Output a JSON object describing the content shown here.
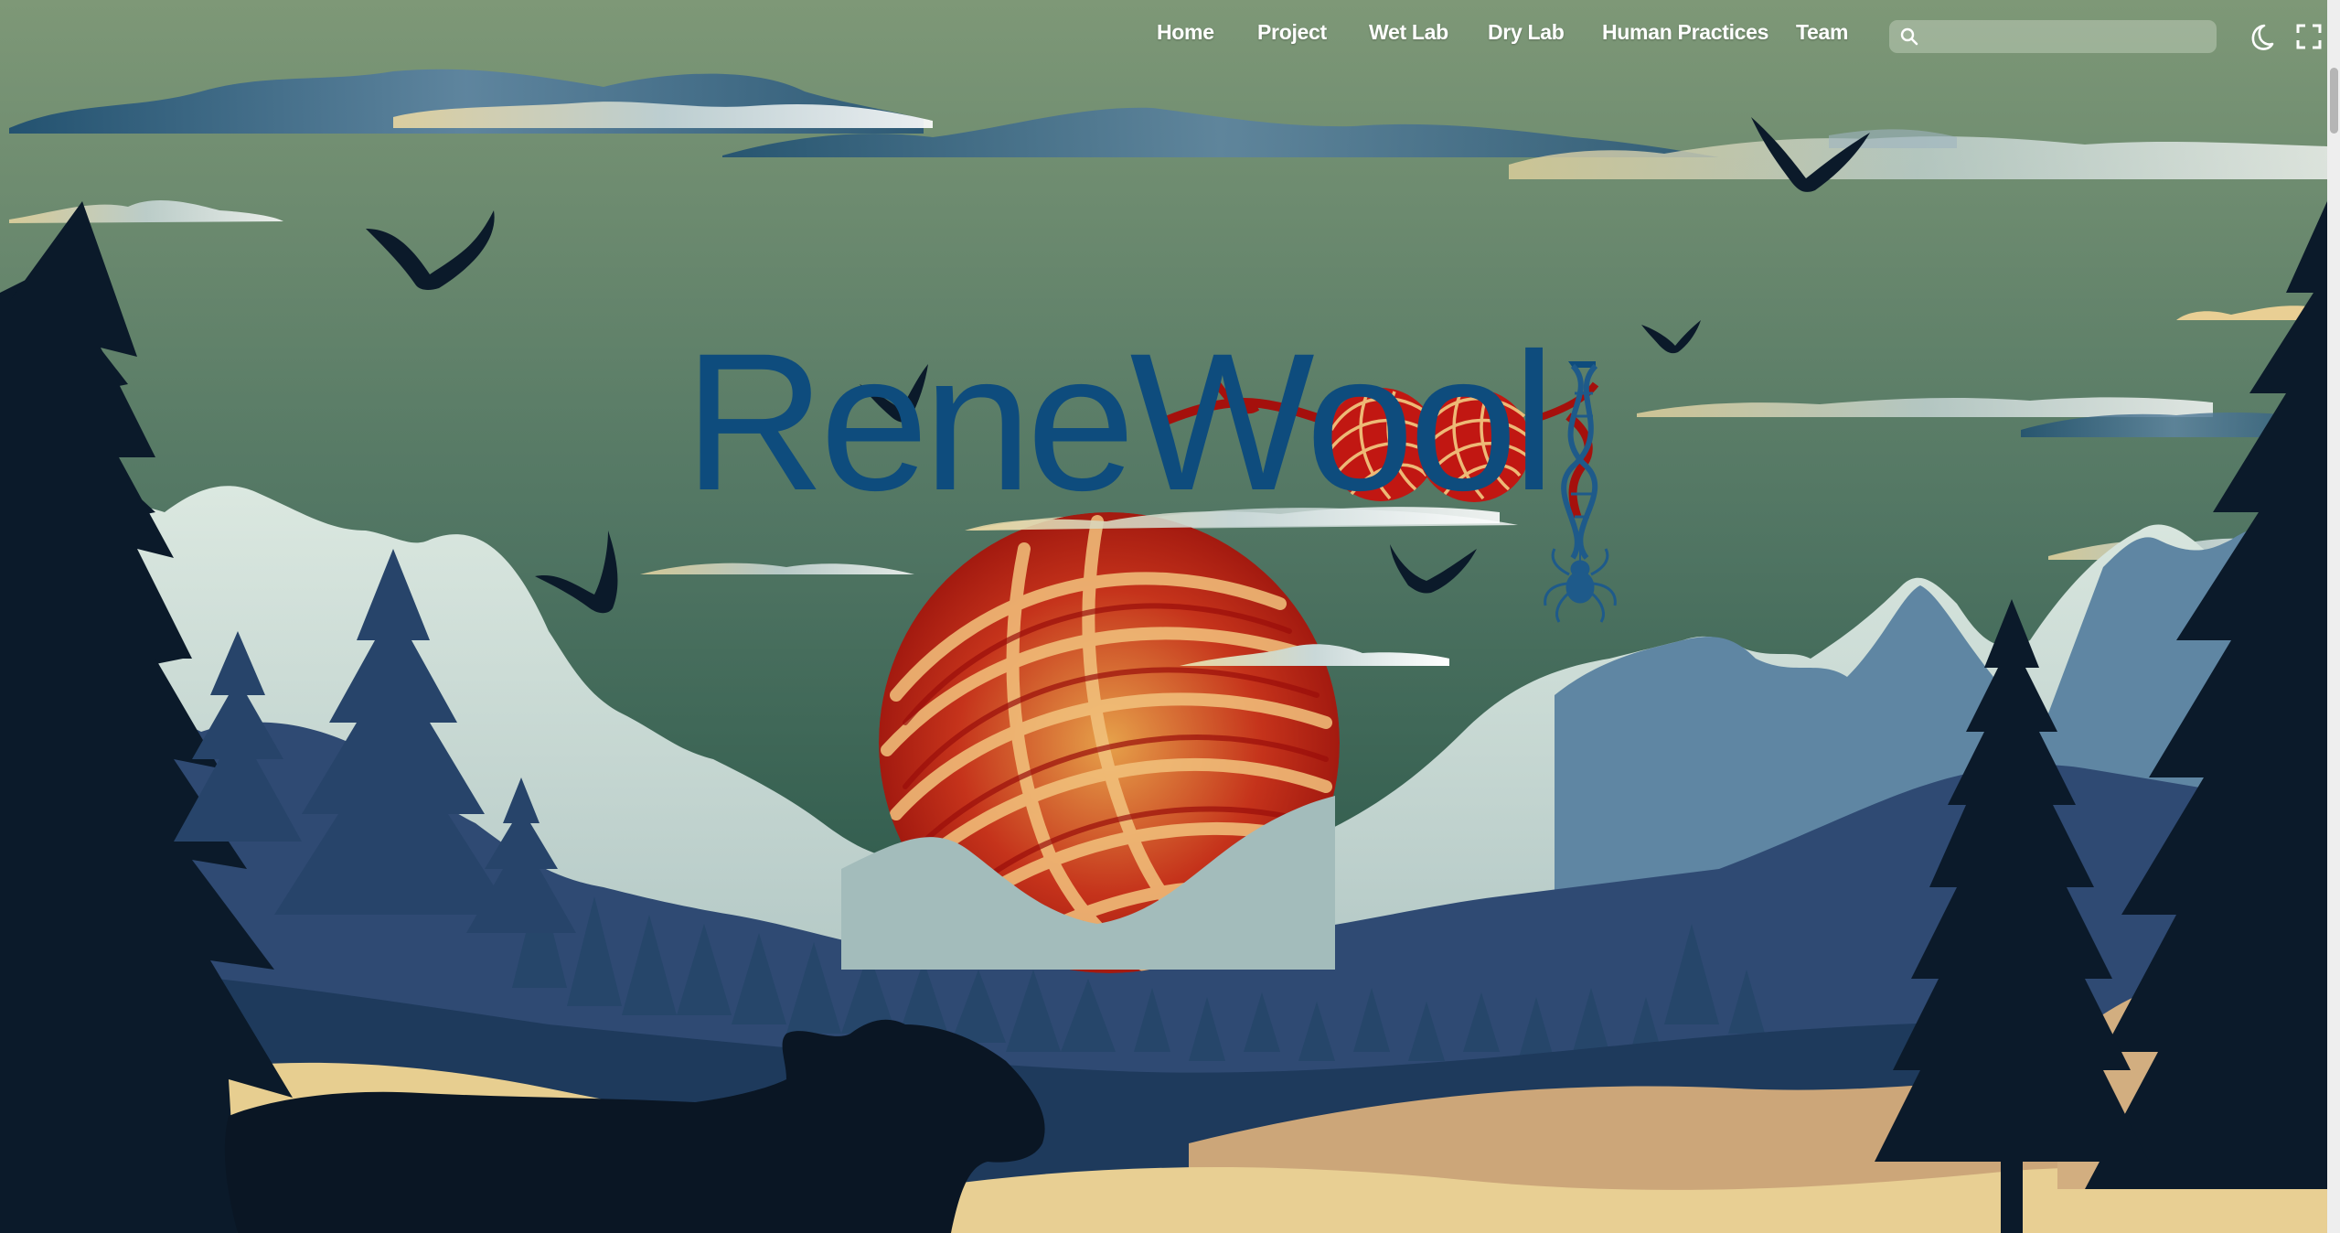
{
  "site": {
    "title": "ReneWool"
  },
  "nav": {
    "items": [
      {
        "label": "Home"
      },
      {
        "label": "Project"
      },
      {
        "label": "Wet Lab"
      },
      {
        "label": "Dry Lab"
      },
      {
        "label": "Human Practices"
      },
      {
        "label": "Team"
      }
    ]
  },
  "search": {
    "placeholder": "",
    "value": ""
  },
  "toolbar": {
    "theme_icon": "moon-icon",
    "fullscreen_icon": "fullscreen-icon"
  },
  "hero": {
    "title": "ReneWool",
    "icons": [
      "yarn-ball-icon",
      "dna-helix-icon",
      "spider-icon",
      "sheep-silhouette",
      "bird-icon",
      "pine-tree-icon"
    ]
  },
  "colors": {
    "sky_top": "#7c9675",
    "sky_bottom": "#2b5648",
    "title_blue": "#0e4c7d",
    "yarn_red": "#b3130e",
    "yarn_gold": "#e9b56b",
    "tree_dark": "#0b1a2a",
    "sand": "#e8cd8e"
  }
}
